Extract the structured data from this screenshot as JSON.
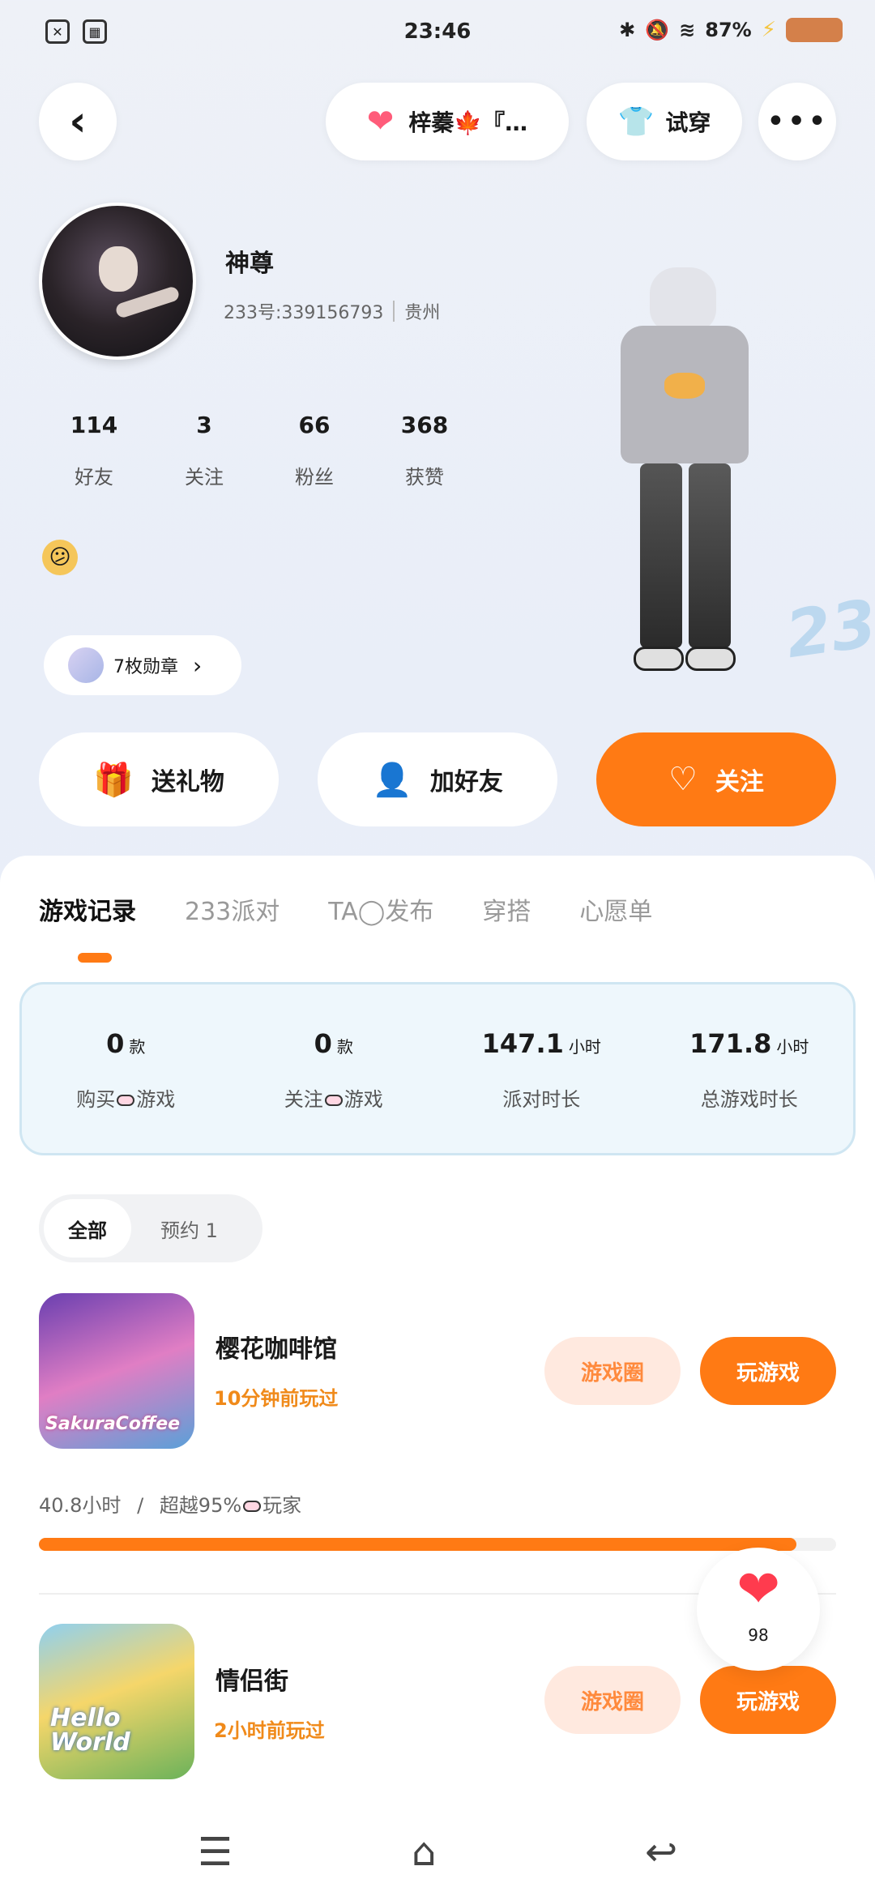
{
  "status": {
    "time": "23:46",
    "battery": "87%"
  },
  "top_bar": {
    "couple_label": "梓蓁🍁『…",
    "tryon_label": "试穿"
  },
  "profile": {
    "name": "神尊",
    "id": "233号:339156793",
    "location": "贵州",
    "stats": [
      {
        "value": "114",
        "label": "好友"
      },
      {
        "value": "3",
        "label": "关注"
      },
      {
        "value": "66",
        "label": "粉丝"
      },
      {
        "value": "368",
        "label": "获赞"
      }
    ],
    "mood_emoji": "😕",
    "badges": "7枚勋章"
  },
  "actions": {
    "gift": "送礼物",
    "add_friend": "加好友",
    "follow": "关注"
  },
  "tabs": [
    "游戏记录",
    "233派对",
    "TA◯发布",
    "穿搭",
    "心愿单"
  ],
  "summary": [
    {
      "value": "0",
      "unit": "款",
      "label_a": "购买",
      "label_b": "游戏"
    },
    {
      "value": "0",
      "unit": "款",
      "label_a": "关注",
      "label_b": "游戏"
    },
    {
      "value": "147.1",
      "unit": "小时",
      "label": "派对时长"
    },
    {
      "value": "171.8",
      "unit": "小时",
      "label": "总游戏时长"
    }
  ],
  "filter": {
    "all": "全部",
    "reserve": "预约 1"
  },
  "games": [
    {
      "name": "樱花咖啡馆",
      "played": "10分钟前玩过",
      "circle": "游戏圈",
      "play": "玩游戏",
      "icon_text": "SakuraCoffee"
    },
    {
      "name": "情侣街",
      "played": "2小时前玩过",
      "circle": "游戏圈",
      "play": "玩游戏",
      "icon_text": "Hello World"
    }
  ],
  "progress": {
    "hours": "40.8小时",
    "sep": "/",
    "beyond_a": "超越95%",
    "beyond_b": "玩家",
    "fraction": 0.95
  },
  "likes": "98",
  "colors": {
    "accent": "#ff7a14",
    "circle_bg": "#ffe9df"
  }
}
